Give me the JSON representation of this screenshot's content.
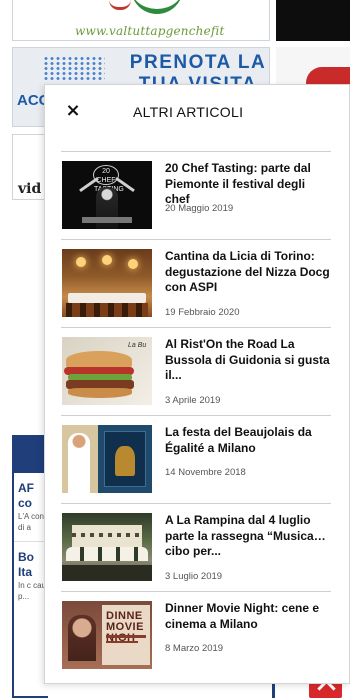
{
  "background": {
    "top_banner_url": "www.valtuttapgenchefit",
    "ad_banner_title": "PRENOTA LA TUA VISITA",
    "ad_banner_brand": "ACC",
    "left_box_text": "vid",
    "left_column_items": [
      {
        "title": "AF co",
        "snippet": "L'A con di a"
      },
      {
        "title": "Bo Ita",
        "snippet": "In c cau p..."
      }
    ]
  },
  "panel": {
    "title": "ALTRI ARTICOLI",
    "close_glyph": "×",
    "articles": [
      {
        "title": "20 Chef Tasting: parte dal Piemonte il festival degli chef",
        "date": "20 Maggio 2019",
        "thumb": "t1",
        "thumb_text": "20 CHEF TASTING"
      },
      {
        "title": "Cantina da Licia di Torino: degustazione del Nizza Docg con ASPI",
        "date": "19 Febbraio 2020",
        "thumb": "t2"
      },
      {
        "title": "Al Rist'On the Road La Bussola di Guidonia si gusta il...",
        "date": "3 Aprile 2019",
        "thumb": "t3",
        "thumb_text": "La Bu"
      },
      {
        "title": "La festa del Beaujolais da Égalité a Milano",
        "date": "14 Novembre 2018",
        "thumb": "t4"
      },
      {
        "title": "A La Rampina dal 4 luglio parte la rassegna “Musica… cibo per...",
        "date": "3 Luglio 2019",
        "thumb": "t5"
      },
      {
        "title": "Dinner Movie Night: cene e cinema a Milano",
        "date": "8 Marzo 2019",
        "thumb": "t6",
        "thumb_text": "DINNE MOVIE NIGH"
      }
    ]
  }
}
